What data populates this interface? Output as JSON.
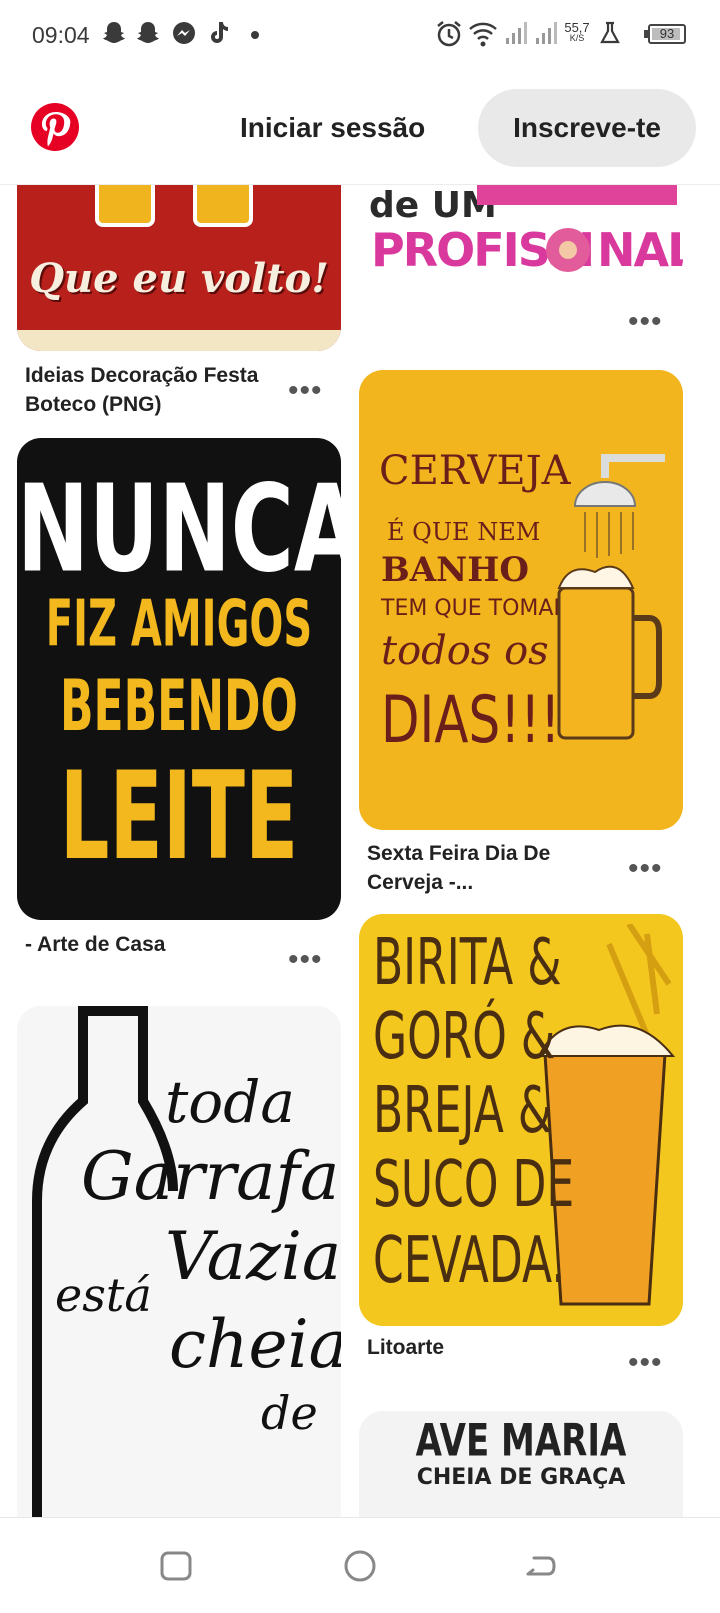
{
  "status_bar": {
    "time": "09:04",
    "speed_top": "55,7",
    "speed_bottom": "K/S",
    "battery": "93",
    "battery_level": 0.93,
    "icons": [
      "snapchat-icon",
      "snapchat-icon",
      "messenger-icon",
      "tiktok-icon",
      "dot-icon",
      "alarm-icon",
      "wifi-icon",
      "signal-icon",
      "signal-icon",
      "lab-icon",
      "battery-icon"
    ]
  },
  "header": {
    "logo": "pinterest-logo",
    "brand_color": "#e60023",
    "login_label": "Iniciar sessão",
    "signup_label": "Inscreve-te"
  },
  "pins": [
    {
      "image_text": [
        "Que eu volto!"
      ],
      "title": "Ideias Decoração Festa Boteco (PNG)",
      "bg": "#b8201c"
    },
    {
      "image_text": [
        "de UM",
        "PROFISSI",
        "NAL"
      ],
      "title": "",
      "bg": "#ffffff"
    },
    {
      "image_text": [
        "NUNCA",
        "FIZ AMIGOS",
        "BEBENDO",
        "LEITE"
      ],
      "title": "- Arte de Casa",
      "bg": "#111111"
    },
    {
      "image_text": [
        "CERVEJA",
        "É QUE NEM",
        "BANHO",
        "TEM QUE TOMAR",
        "todos os",
        "DIAS!!!"
      ],
      "title": "Sexta Feira Dia De Cerveja -...",
      "bg": "#f2b51d"
    },
    {
      "image_text": [
        "toda",
        "Garrafa",
        "Vazia",
        "está",
        "cheia",
        "de"
      ],
      "title": "",
      "bg": "#f6f6f6"
    },
    {
      "image_text": [
        "BIRITA &",
        "GORÓ &",
        "BREJA &",
        "SUCO DE",
        "CEVADA."
      ],
      "title": "Litoarte",
      "bg": "#f4c71f"
    },
    {
      "image_text": [
        "AVE MARIA",
        "CHEIA DE GRAÇA"
      ],
      "title": "",
      "bg": "#f3f3f3"
    }
  ],
  "more_label": "•••",
  "nav": {
    "buttons": [
      "recents-button",
      "home-button",
      "back-button"
    ]
  }
}
